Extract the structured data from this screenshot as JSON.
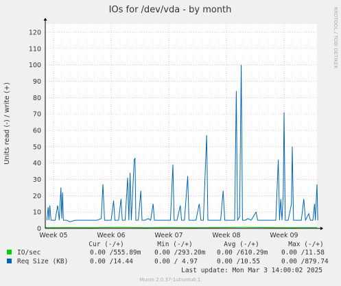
{
  "title": "IOs for /dev/vda - by month",
  "watermark": "RRDTOOL / TOBI OETIKER",
  "footer": "Munin 2.0.37-1ubuntu0.1",
  "colors": {
    "background": "#f0f0f0",
    "plot_bg": "#ffffff",
    "io_series": "#00cc00",
    "req_series": "#0066b3",
    "grid_major": "#e8a0a0",
    "axis": "#000000"
  },
  "legend": {
    "headers": [
      "Cur (-/+)",
      "Min (-/+)",
      "Avg (-/+)",
      "Max (-/+)"
    ],
    "rows": [
      {
        "swatch": "#00cc00",
        "name": "IO/sec",
        "cur": "0.00 /555.89m",
        "min": "0.00 /293.20m",
        "avg": "0.00 /610.29m",
        "max": "0.00 /11.58"
      },
      {
        "swatch": "#0066b3",
        "name": "Req Size (KB)",
        "cur": "0.00 /14.44",
        "min": "0.00 / 4.97",
        "avg": "0.00 /10.55",
        "max": "0.00 /879.74"
      }
    ],
    "last_update": "Last update: Mon Mar  3 14:00:02 2025"
  },
  "chart_data": {
    "type": "line",
    "title": "IOs for /dev/vda - by month",
    "ylabel": "Units read (-) / write (+)",
    "xlabel": "",
    "ylim": [
      0,
      125
    ],
    "yticks": [
      0,
      10,
      20,
      30,
      40,
      50,
      60,
      70,
      80,
      90,
      100,
      110,
      120
    ],
    "x_ticks": [
      "Week 05",
      "Week 06",
      "Week 07",
      "Week 08",
      "Week 09"
    ],
    "x_range_days": [
      0,
      33
    ],
    "x_tick_days": [
      1,
      8,
      15,
      22,
      29
    ],
    "grid": true,
    "series": [
      {
        "name": "Req Size (KB)",
        "color": "#0066b3",
        "points": [
          [
            0.2,
            5
          ],
          [
            0.35,
            13
          ],
          [
            0.45,
            5
          ],
          [
            0.55,
            14
          ],
          [
            0.7,
            5
          ],
          [
            1.2,
            5
          ],
          [
            1.5,
            14
          ],
          [
            1.7,
            5
          ],
          [
            1.9,
            25
          ],
          [
            2.0,
            6
          ],
          [
            2.1,
            22
          ],
          [
            2.2,
            5
          ],
          [
            2.6,
            5
          ],
          [
            3.0,
            4
          ],
          [
            3.6,
            5
          ],
          [
            4.2,
            5
          ],
          [
            4.6,
            5
          ],
          [
            5.1,
            5
          ],
          [
            5.5,
            5
          ],
          [
            6.0,
            5
          ],
          [
            6.3,
            5
          ],
          [
            6.8,
            6
          ],
          [
            7.0,
            27
          ],
          [
            7.2,
            5
          ],
          [
            7.6,
            5
          ],
          [
            8.0,
            5
          ],
          [
            8.3,
            17
          ],
          [
            8.45,
            5
          ],
          [
            8.9,
            5
          ],
          [
            9.2,
            18
          ],
          [
            9.35,
            5
          ],
          [
            9.7,
            5
          ],
          [
            10.0,
            31
          ],
          [
            10.15,
            5
          ],
          [
            10.3,
            34
          ],
          [
            10.45,
            5
          ],
          [
            10.8,
            42
          ],
          [
            10.9,
            43
          ],
          [
            11.0,
            5
          ],
          [
            11.3,
            5
          ],
          [
            11.6,
            23
          ],
          [
            11.75,
            5
          ],
          [
            12.1,
            5
          ],
          [
            12.5,
            6
          ],
          [
            12.8,
            5
          ],
          [
            13.1,
            15
          ],
          [
            13.25,
            5
          ],
          [
            13.5,
            5
          ],
          [
            14.0,
            5
          ],
          [
            14.4,
            5
          ],
          [
            14.8,
            5
          ],
          [
            15.2,
            5
          ],
          [
            15.5,
            39
          ],
          [
            15.65,
            5
          ],
          [
            16.0,
            5
          ],
          [
            16.4,
            14
          ],
          [
            16.55,
            5
          ],
          [
            16.9,
            5
          ],
          [
            17.3,
            32
          ],
          [
            17.45,
            5
          ],
          [
            17.8,
            5
          ],
          [
            18.3,
            5
          ],
          [
            18.7,
            15
          ],
          [
            18.9,
            5
          ],
          [
            19.2,
            5
          ],
          [
            19.6,
            57
          ],
          [
            19.75,
            5
          ],
          [
            20.2,
            5
          ],
          [
            20.6,
            5
          ],
          [
            21.0,
            5
          ],
          [
            21.3,
            5
          ],
          [
            21.6,
            23
          ],
          [
            21.8,
            5
          ],
          [
            22.1,
            5
          ],
          [
            22.5,
            5
          ],
          [
            23.0,
            5
          ],
          [
            23.2,
            84
          ],
          [
            23.35,
            5
          ],
          [
            23.6,
            7
          ],
          [
            23.8,
            100
          ],
          [
            23.95,
            5
          ],
          [
            24.3,
            5
          ],
          [
            24.6,
            6
          ],
          [
            25.0,
            5
          ],
          [
            25.6,
            10
          ],
          [
            25.8,
            5
          ],
          [
            26.2,
            5
          ],
          [
            26.6,
            5
          ],
          [
            27.0,
            5
          ],
          [
            27.3,
            5
          ],
          [
            27.7,
            5
          ],
          [
            28.0,
            5
          ],
          [
            28.3,
            42
          ],
          [
            28.45,
            5
          ],
          [
            28.6,
            18
          ],
          [
            28.75,
            5
          ],
          [
            28.9,
            21
          ],
          [
            29.0,
            71
          ],
          [
            29.15,
            5
          ],
          [
            29.5,
            5
          ],
          [
            29.9,
            15
          ],
          [
            30.0,
            50
          ],
          [
            30.15,
            5
          ],
          [
            30.6,
            5
          ],
          [
            31.1,
            5
          ],
          [
            31.4,
            18
          ],
          [
            31.6,
            5
          ],
          [
            32.0,
            9
          ],
          [
            32.2,
            5
          ],
          [
            32.5,
            5
          ],
          [
            32.7,
            15
          ],
          [
            32.8,
            5
          ],
          [
            33.0,
            27
          ],
          [
            33.1,
            5
          ]
        ]
      },
      {
        "name": "IO/sec",
        "color": "#00cc00",
        "points": [
          [
            0,
            0.5
          ],
          [
            3,
            0.6
          ],
          [
            6,
            0.5
          ],
          [
            9,
            0.7
          ],
          [
            12,
            0.5
          ],
          [
            15,
            0.6
          ],
          [
            18,
            0.5
          ],
          [
            21,
            0.6
          ],
          [
            24,
            0.7
          ],
          [
            27,
            0.6
          ],
          [
            30,
            0.5
          ],
          [
            33,
            0.6
          ]
        ]
      }
    ]
  }
}
